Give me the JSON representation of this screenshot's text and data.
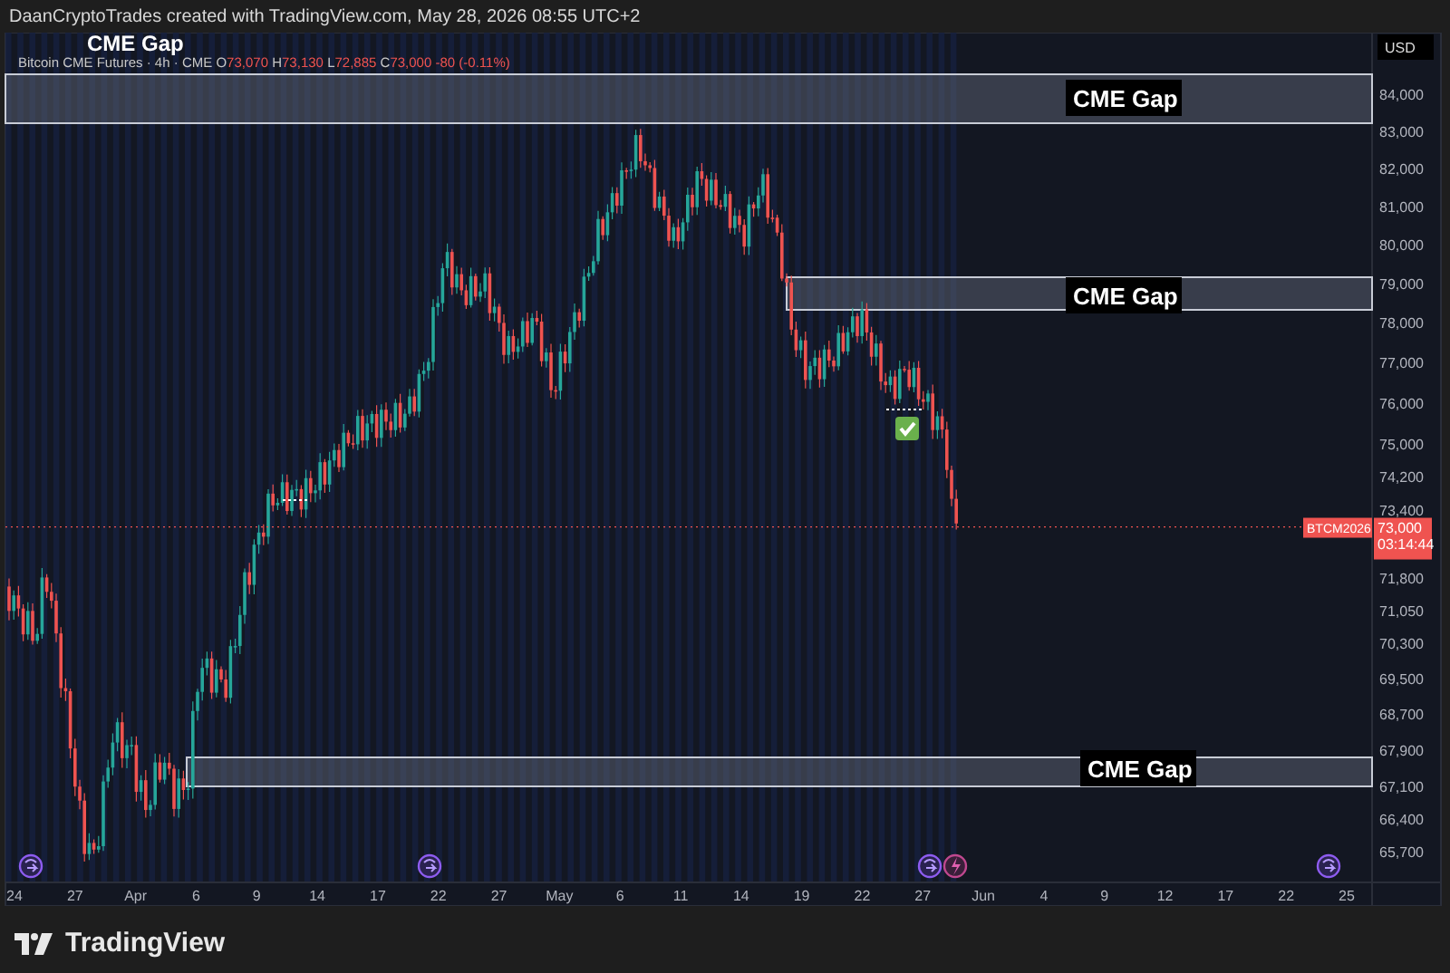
{
  "header": {
    "credit": "DaanCryptoTrades created with TradingView.com, May 28, 2026 08:55 UTC+2"
  },
  "chart": {
    "legend": {
      "symbol": "Bitcoin CME Futures · 4h · CME",
      "open_label": "O",
      "open": "73,070",
      "high_label": "H",
      "high": "73,130",
      "low_label": "L",
      "low": "72,885",
      "close_label": "C",
      "close": "73,000",
      "change": "-80 (-0.11%)"
    },
    "currency": "USD",
    "partial_gap_label": "CME Gap",
    "gaps": [
      {
        "label": "CME Gap"
      },
      {
        "label": "CME Gap"
      },
      {
        "label": "CME Gap"
      }
    ],
    "price_axis": [
      "84,000",
      "83,000",
      "82,000",
      "81,000",
      "80,000",
      "79,000",
      "78,000",
      "77,000",
      "76,000",
      "75,000",
      "74,200",
      "73,400",
      "71,800",
      "71,050",
      "70,300",
      "69,500",
      "68,700",
      "67,900",
      "67,100",
      "66,400",
      "65,700"
    ],
    "current_price": {
      "symbol": "BTCM2026",
      "price": "73,000",
      "countdown": "03:14:44"
    },
    "time_axis": [
      "24",
      "27",
      "Apr",
      "6",
      "9",
      "14",
      "17",
      "22",
      "27",
      "May",
      "6",
      "11",
      "14",
      "19",
      "22",
      "27",
      "Jun",
      "4",
      "9",
      "12",
      "17",
      "22",
      "25"
    ],
    "events": [
      {
        "kind": "rollover"
      },
      {
        "kind": "rollover"
      },
      {
        "kind": "rollover"
      },
      {
        "kind": "flash"
      },
      {
        "kind": "rollover"
      }
    ]
  },
  "footer": {
    "brand": "TradingView"
  }
}
